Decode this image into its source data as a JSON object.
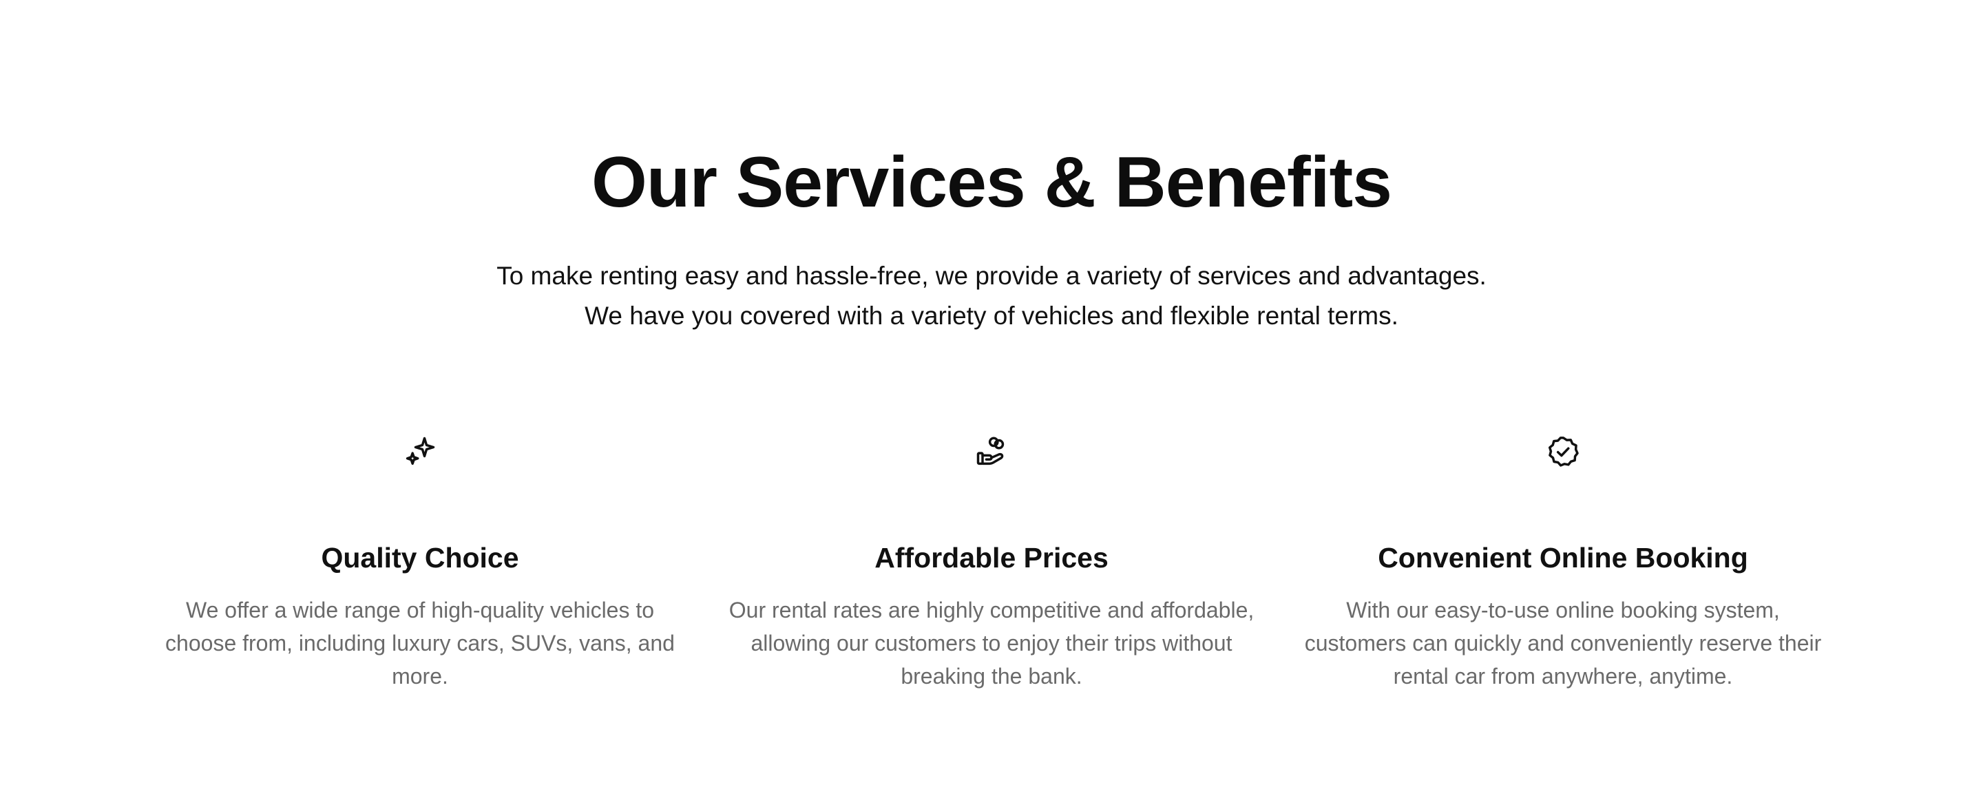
{
  "section": {
    "title": "Our Services & Benefits",
    "intro": "To make renting easy and hassle-free, we provide a variety of services and advantages. We have you covered with a variety of vehicles and flexible rental terms."
  },
  "features": [
    {
      "icon": "sparkles-icon",
      "title": "Quality Choice",
      "description": "We offer a wide range of high-quality vehicles to choose from, including luxury cars, SUVs, vans, and more."
    },
    {
      "icon": "hand-coins-icon",
      "title": "Affordable Prices",
      "description": "Our rental rates are highly competitive and affordable, allowing our customers to enjoy their trips without breaking the bank."
    },
    {
      "icon": "badge-check-icon",
      "title": "Convenient Online Booking",
      "description": "With our easy-to-use online booking system, customers can quickly and conveniently reserve their rental car from anywhere, anytime."
    }
  ]
}
